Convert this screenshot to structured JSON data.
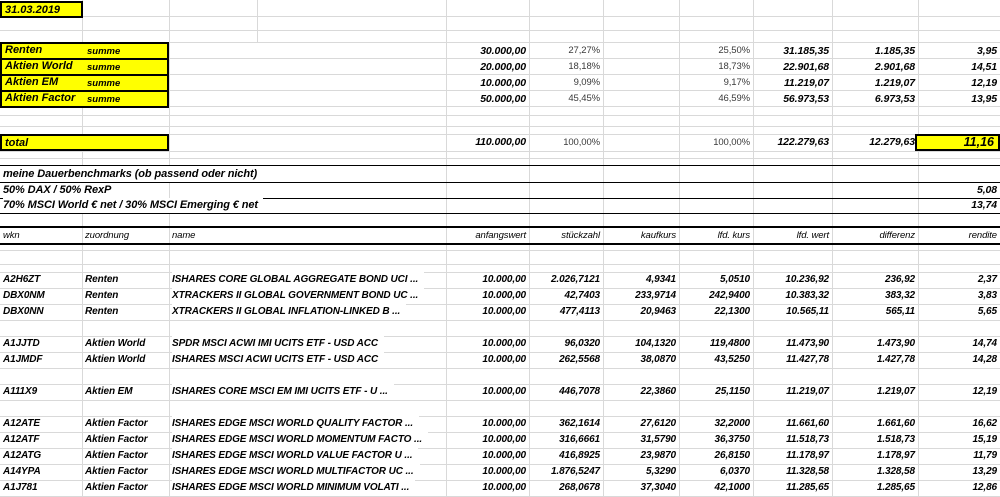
{
  "colors": {
    "highlight": "#ffff00",
    "gridline": "#d9d9d9"
  },
  "date": "31.03.2019",
  "summary": {
    "rows": [
      {
        "label": "Renten",
        "sub": "summe",
        "anfangswert": "30.000,00",
        "pct_target": "27,27%",
        "pct_actual": "25,50%",
        "wert": "31.185,35",
        "differenz": "1.185,35",
        "rendite": "3,95"
      },
      {
        "label": "Aktien World",
        "sub": "summe",
        "anfangswert": "20.000,00",
        "pct_target": "18,18%",
        "pct_actual": "18,73%",
        "wert": "22.901,68",
        "differenz": "2.901,68",
        "rendite": "14,51"
      },
      {
        "label": "Aktien EM",
        "sub": "summe",
        "anfangswert": "10.000,00",
        "pct_target": "9,09%",
        "pct_actual": "9,17%",
        "wert": "11.219,07",
        "differenz": "1.219,07",
        "rendite": "12,19"
      },
      {
        "label": "Aktien Factor",
        "sub": "summe",
        "anfangswert": "50.000,00",
        "pct_target": "45,45%",
        "pct_actual": "46,59%",
        "wert": "56.973,53",
        "differenz": "6.973,53",
        "rendite": "13,95"
      }
    ],
    "total": {
      "label": "total",
      "anfangswert": "110.000,00",
      "pct_target": "100,00%",
      "pct_actual": "100,00%",
      "wert": "122.279,63",
      "differenz": "12.279,63",
      "rendite": "11,16"
    }
  },
  "benchmarks": {
    "title": "meine Dauerbenchmarks (ob passend oder nicht)",
    "rows": [
      {
        "label": "50% DAX / 50% RexP",
        "rendite": "5,08"
      },
      {
        "label": "70% MSCI World € net / 30% MSCI Emerging € net",
        "rendite": "13,74"
      }
    ]
  },
  "table": {
    "headers": {
      "wkn": "wkn",
      "zuordnung": "zuordnung",
      "name": "name",
      "anfangswert": "anfangswert",
      "stueckzahl": "stückzahl",
      "kaufkurs": "kaufkurs",
      "lfd_kurs": "lfd. kurs",
      "lfd_wert": "lfd. wert",
      "differenz": "differenz",
      "rendite": "rendite"
    },
    "rows": [
      {
        "wkn": "A2H6ZT",
        "zuordnung": "Renten",
        "name": "ISHARES CORE GLOBAL AGGREGATE BOND UCI ...",
        "anfangswert": "10.000,00",
        "stueckzahl": "2.026,7121",
        "kaufkurs": "4,9341",
        "lfd_kurs": "5,0510",
        "lfd_wert": "10.236,92",
        "differenz": "236,92",
        "rendite": "2,37"
      },
      {
        "wkn": "DBX0NM",
        "zuordnung": "Renten",
        "name": "XTRACKERS II GLOBAL GOVERNMENT BOND UC ...",
        "anfangswert": "10.000,00",
        "stueckzahl": "42,7403",
        "kaufkurs": "233,9714",
        "lfd_kurs": "242,9400",
        "lfd_wert": "10.383,32",
        "differenz": "383,32",
        "rendite": "3,83"
      },
      {
        "wkn": "DBX0NN",
        "zuordnung": "Renten",
        "name": "XTRACKERS II GLOBAL INFLATION-LINKED B ...",
        "anfangswert": "10.000,00",
        "stueckzahl": "477,4113",
        "kaufkurs": "20,9463",
        "lfd_kurs": "22,1300",
        "lfd_wert": "10.565,11",
        "differenz": "565,11",
        "rendite": "5,65"
      },
      {
        "wkn": "A1JJTD",
        "zuordnung": "Aktien World",
        "name": "SPDR MSCI ACWI IMI UCITS ETF - USD ACC",
        "anfangswert": "10.000,00",
        "stueckzahl": "96,0320",
        "kaufkurs": "104,1320",
        "lfd_kurs": "119,4800",
        "lfd_wert": "11.473,90",
        "differenz": "1.473,90",
        "rendite": "14,74"
      },
      {
        "wkn": "A1JMDF",
        "zuordnung": "Aktien World",
        "name": "ISHARES MSCI ACWI UCITS ETF - USD ACC",
        "anfangswert": "10.000,00",
        "stueckzahl": "262,5568",
        "kaufkurs": "38,0870",
        "lfd_kurs": "43,5250",
        "lfd_wert": "11.427,78",
        "differenz": "1.427,78",
        "rendite": "14,28"
      },
      {
        "wkn": "A111X9",
        "zuordnung": "Aktien EM",
        "name": "ISHARES CORE MSCI EM IMI UCITS ETF - U ...",
        "anfangswert": "10.000,00",
        "stueckzahl": "446,7078",
        "kaufkurs": "22,3860",
        "lfd_kurs": "25,1150",
        "lfd_wert": "11.219,07",
        "differenz": "1.219,07",
        "rendite": "12,19"
      },
      {
        "wkn": "A12ATE",
        "zuordnung": "Aktien Factor",
        "name": "ISHARES EDGE MSCI WORLD QUALITY FACTOR ...",
        "anfangswert": "10.000,00",
        "stueckzahl": "362,1614",
        "kaufkurs": "27,6120",
        "lfd_kurs": "32,2000",
        "lfd_wert": "11.661,60",
        "differenz": "1.661,60",
        "rendite": "16,62"
      },
      {
        "wkn": "A12ATF",
        "zuordnung": "Aktien Factor",
        "name": "ISHARES EDGE MSCI WORLD MOMENTUM FACTO ...",
        "anfangswert": "10.000,00",
        "stueckzahl": "316,6661",
        "kaufkurs": "31,5790",
        "lfd_kurs": "36,3750",
        "lfd_wert": "11.518,73",
        "differenz": "1.518,73",
        "rendite": "15,19"
      },
      {
        "wkn": "A12ATG",
        "zuordnung": "Aktien Factor",
        "name": "ISHARES EDGE MSCI WORLD VALUE FACTOR U ...",
        "anfangswert": "10.000,00",
        "stueckzahl": "416,8925",
        "kaufkurs": "23,9870",
        "lfd_kurs": "26,8150",
        "lfd_wert": "11.178,97",
        "differenz": "1.178,97",
        "rendite": "11,79"
      },
      {
        "wkn": "A14YPA",
        "zuordnung": "Aktien Factor",
        "name": "ISHARES EDGE MSCI WORLD MULTIFACTOR UC ...",
        "anfangswert": "10.000,00",
        "stueckzahl": "1.876,5247",
        "kaufkurs": "5,3290",
        "lfd_kurs": "6,0370",
        "lfd_wert": "11.328,58",
        "differenz": "1.328,58",
        "rendite": "13,29"
      },
      {
        "wkn": "A1J781",
        "zuordnung": "Aktien Factor",
        "name": "ISHARES EDGE MSCI WORLD MINIMUM VOLATI ...",
        "anfangswert": "10.000,00",
        "stueckzahl": "268,0678",
        "kaufkurs": "37,3040",
        "lfd_kurs": "42,1000",
        "lfd_wert": "11.285,65",
        "differenz": "1.285,65",
        "rendite": "12,86"
      }
    ]
  }
}
